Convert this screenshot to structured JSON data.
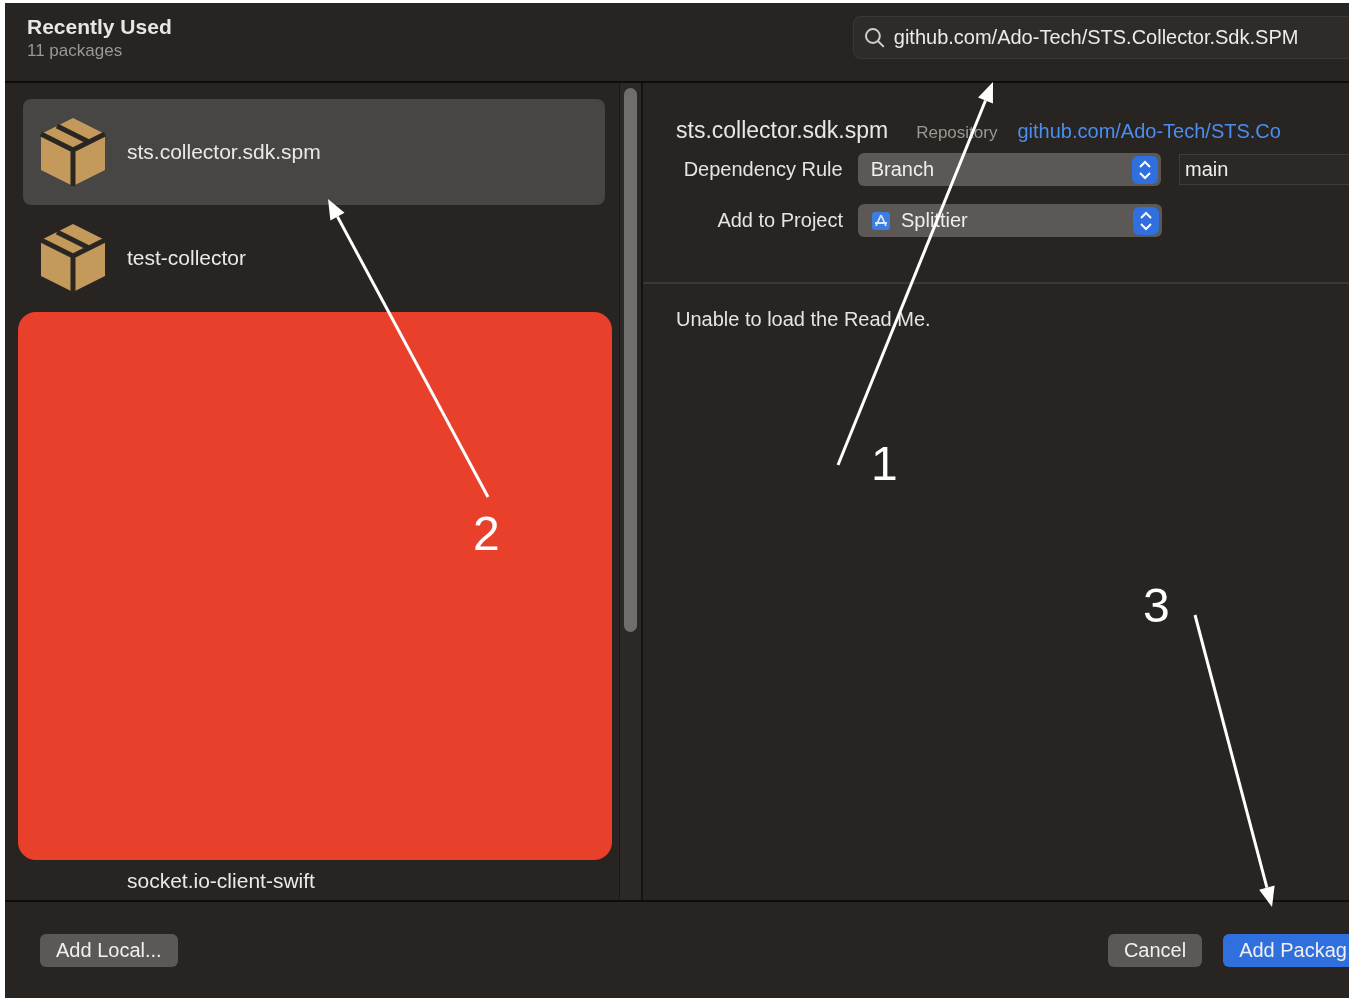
{
  "header": {
    "title": "Recently Used",
    "subtitle": "11 packages"
  },
  "search": {
    "value": "github.com/Ado-Tech/STS.Collector.Sdk.SPM"
  },
  "packages": [
    {
      "name": "sts.collector.sdk.spm",
      "selected": true
    },
    {
      "name": "test-collector",
      "selected": false
    },
    {
      "name": "socket.io-client-swift",
      "selected": false
    }
  ],
  "detail": {
    "name": "sts.collector.sdk.spm",
    "repository_label": "Repository",
    "repository_link": "github.com/Ado-Tech/STS.Co",
    "rows": [
      {
        "label": "Dependency Rule",
        "popup": "Branch",
        "project_icon": false,
        "text_field": "main"
      },
      {
        "label": "Add to Project",
        "popup": "Splittier",
        "project_icon": true
      }
    ],
    "readme_message": "Unable to load the Read Me."
  },
  "footer": {
    "buttons": [
      {
        "label": "Add Local...",
        "kind": "secondary"
      },
      {
        "label": "Cancel",
        "kind": "secondary"
      },
      {
        "label": "Add Packag",
        "kind": "primary"
      }
    ]
  },
  "annotations": [
    {
      "label": "1"
    },
    {
      "label": "2"
    },
    {
      "label": "3"
    }
  ]
}
